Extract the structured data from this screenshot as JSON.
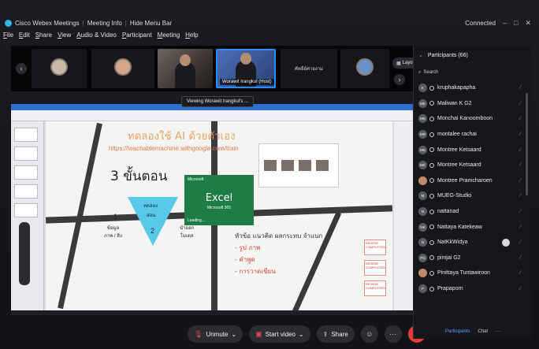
{
  "app": {
    "title": "Cisco Webex Meetings",
    "meeting_info": "Meeting Info",
    "hide_menu": "Hide Menu Bar",
    "connected": "Connected",
    "window_controls": [
      "–",
      "□",
      "✕"
    ]
  },
  "menu": [
    "File",
    "Edit",
    "Share",
    "View",
    "Audio & Video",
    "Participant",
    "Meeting",
    "Help"
  ],
  "video_strip": {
    "active_name": "Worawit Irangkul (Host)",
    "text_tile": "คัทลีย์ค่ายงาม",
    "layout_label": "Layout"
  },
  "share": {
    "viewing": "Viewing Worawit Irangkul's ...",
    "heading": "ทดลองใช้ AI ด้วยตัวเอง",
    "link": "https://teachablemachine.withgoogle.com/train",
    "steps_title": "3 ขั้นตอน",
    "funnel": {
      "top": "ทดลอง",
      "mid": "สอน",
      "num": "2"
    },
    "left_step": {
      "num": "1",
      "text": "ข้อมูล\nภาพ / สิ่ง"
    },
    "right_step": {
      "num": "3",
      "text": "นำออก\nโมเดล"
    },
    "excel": {
      "brand": "Microsoft",
      "name": "Excel",
      "version": "Microsoft 365",
      "loading": "Loading..."
    },
    "bullets": {
      "header": "หัวข้อ แนวคิด ผลกระทบ จำแนก",
      "items": [
        "- รูป  ภาพ",
        "- คำพูด",
        "- การวาดเขียน"
      ]
    },
    "sticky_notes": [
      "REVIEW COMPLETED",
      "REVIEW COMPLETED",
      "REVIEW COMPLETED"
    ]
  },
  "toolbar": {
    "unmute": "Unmute",
    "start_video": "Start video",
    "share": "Share"
  },
  "participants": {
    "title": "Participants (66)",
    "search_placeholder": "Search",
    "list": [
      {
        "initials": "K",
        "name": "kruphakapapha"
      },
      {
        "initials": "MK",
        "name": "Maliwan K G2"
      },
      {
        "initials": "MK",
        "name": "Monchai Kanoomboon"
      },
      {
        "initials": "MR",
        "name": "montalee rachai"
      },
      {
        "initials": "MK",
        "name": "Montree Ketsaard"
      },
      {
        "initials": "MK",
        "name": "Montree Ketsaard"
      },
      {
        "initials": "",
        "name": "Montree Pramcharoen",
        "photo": true
      },
      {
        "initials": "M",
        "name": "MUEG-Studio"
      },
      {
        "initials": "N",
        "name": "nattanad"
      },
      {
        "initials": "NK",
        "name": "Nattaya Katekeaw"
      },
      {
        "initials": "N",
        "name": "NatKkWidya",
        "self": true
      },
      {
        "initials": "PG",
        "name": "pimjai G2"
      },
      {
        "initials": "",
        "name": "Pinittaya Tuntawiroon",
        "photo": true
      },
      {
        "initials": "P",
        "name": "Prapaporn"
      }
    ],
    "footer_participants": "Participants",
    "footer_chat": "Chat"
  }
}
